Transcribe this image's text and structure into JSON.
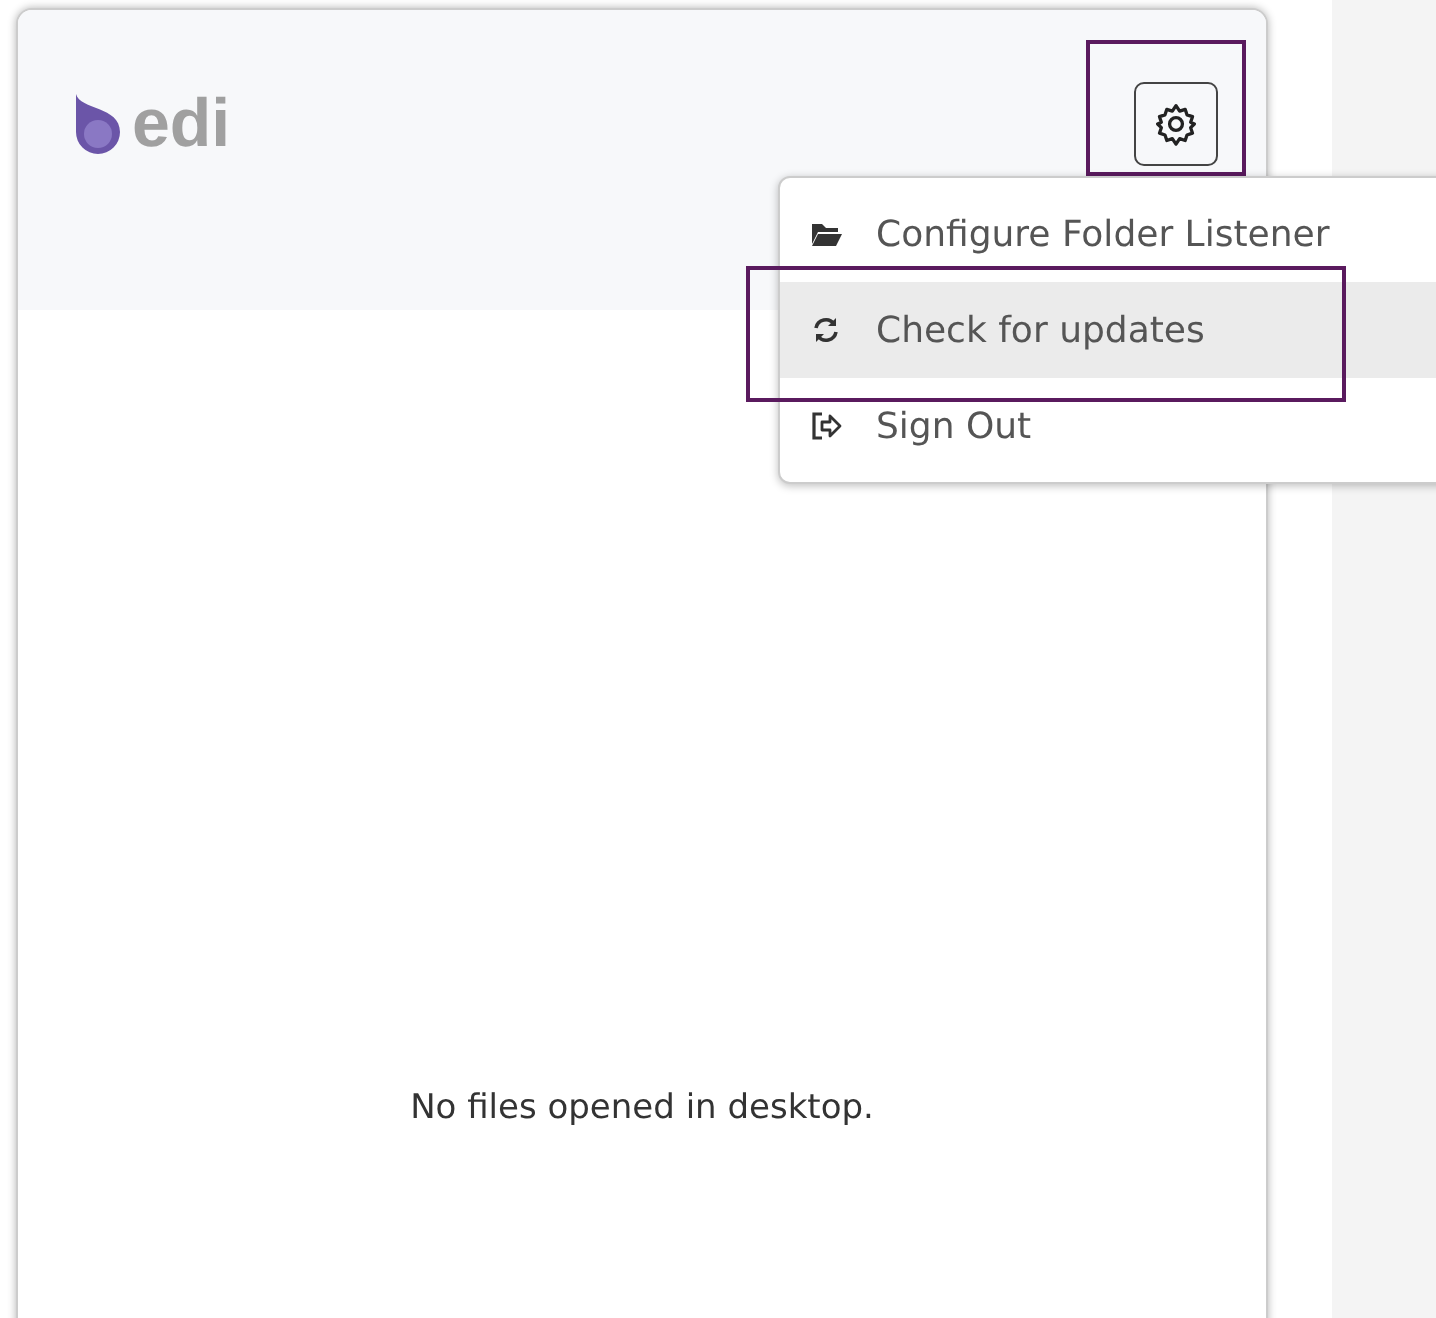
{
  "header": {
    "logo_text": "edi",
    "settings_button": {
      "highlighted": true
    }
  },
  "menu": {
    "items": [
      {
        "kind": "folder",
        "label": "Configure Folder Listener",
        "hovered": false,
        "highlighted": false
      },
      {
        "kind": "refresh",
        "label": "Check for updates",
        "hovered": true,
        "highlighted": true
      },
      {
        "kind": "signout",
        "label": "Sign Out",
        "hovered": false,
        "highlighted": false
      }
    ]
  },
  "empty_message": "No files opened in desktop."
}
